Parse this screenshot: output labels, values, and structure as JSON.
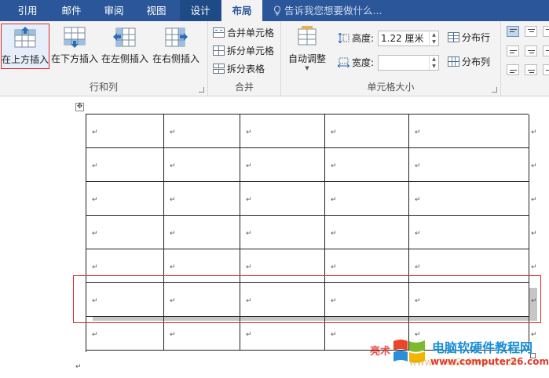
{
  "tabs": [
    {
      "label": "引用"
    },
    {
      "label": "邮件"
    },
    {
      "label": "审阅"
    },
    {
      "label": "视图"
    },
    {
      "label": "设计"
    },
    {
      "label": "布局"
    }
  ],
  "search": {
    "hint": "告诉我您想要做什么..."
  },
  "rows_cols": {
    "label": "行和列",
    "insert_above": "在上方插入",
    "insert_below": "在下方插入",
    "insert_left": "在左侧插入",
    "insert_right": "在右侧插入"
  },
  "merge": {
    "label": "合并",
    "merge_cells": "合并单元格",
    "split_cells": "拆分单元格",
    "split_table": "拆分表格"
  },
  "cell_size": {
    "label": "单元格大小",
    "autofit": "自动调整",
    "height_label": "高度:",
    "height_value": "1.22 厘米",
    "width_label": "宽度:",
    "width_value": "",
    "distribute_rows": "分布行",
    "distribute_cols": "分布列"
  },
  "table": {
    "rows": 7,
    "cols": 5,
    "selected_row": 6,
    "para_mark": "↵"
  },
  "watermark": {
    "left_text": "亮术",
    "title": "电脑软硬件教程网",
    "url": "www.computer26.com",
    "faint_url": "www.YiHuSoftware.com"
  },
  "colors": {
    "tab_bar": "#2b579a",
    "ribbon": "#f3f3f3",
    "selection_frame": "#e0282a",
    "row_highlight": "#c6c6c6"
  }
}
